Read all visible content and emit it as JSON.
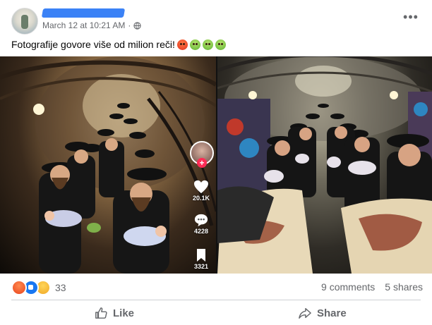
{
  "post": {
    "timestamp": "March 12 at 10:21 AM",
    "separator": "·",
    "caption": "Fotografije govore više od milion reči!",
    "caption_emojis": [
      "angry-face-emoji",
      "nauseated-face-emoji",
      "nauseated-face-emoji",
      "nauseated-face-emoji"
    ]
  },
  "media": {
    "left_photo": {
      "likes": "20.1K",
      "comments": "4228",
      "bookmarks": "3321",
      "follow_icon": "+"
    }
  },
  "footer": {
    "reaction_count": "33",
    "comments": "9 comments",
    "shares": "5 shares",
    "like_label": "Like",
    "share_label": "Share"
  },
  "colors": {
    "accent": "#1877f2",
    "secondary_text": "#65676b",
    "tiktok_red": "#fe2c55"
  }
}
